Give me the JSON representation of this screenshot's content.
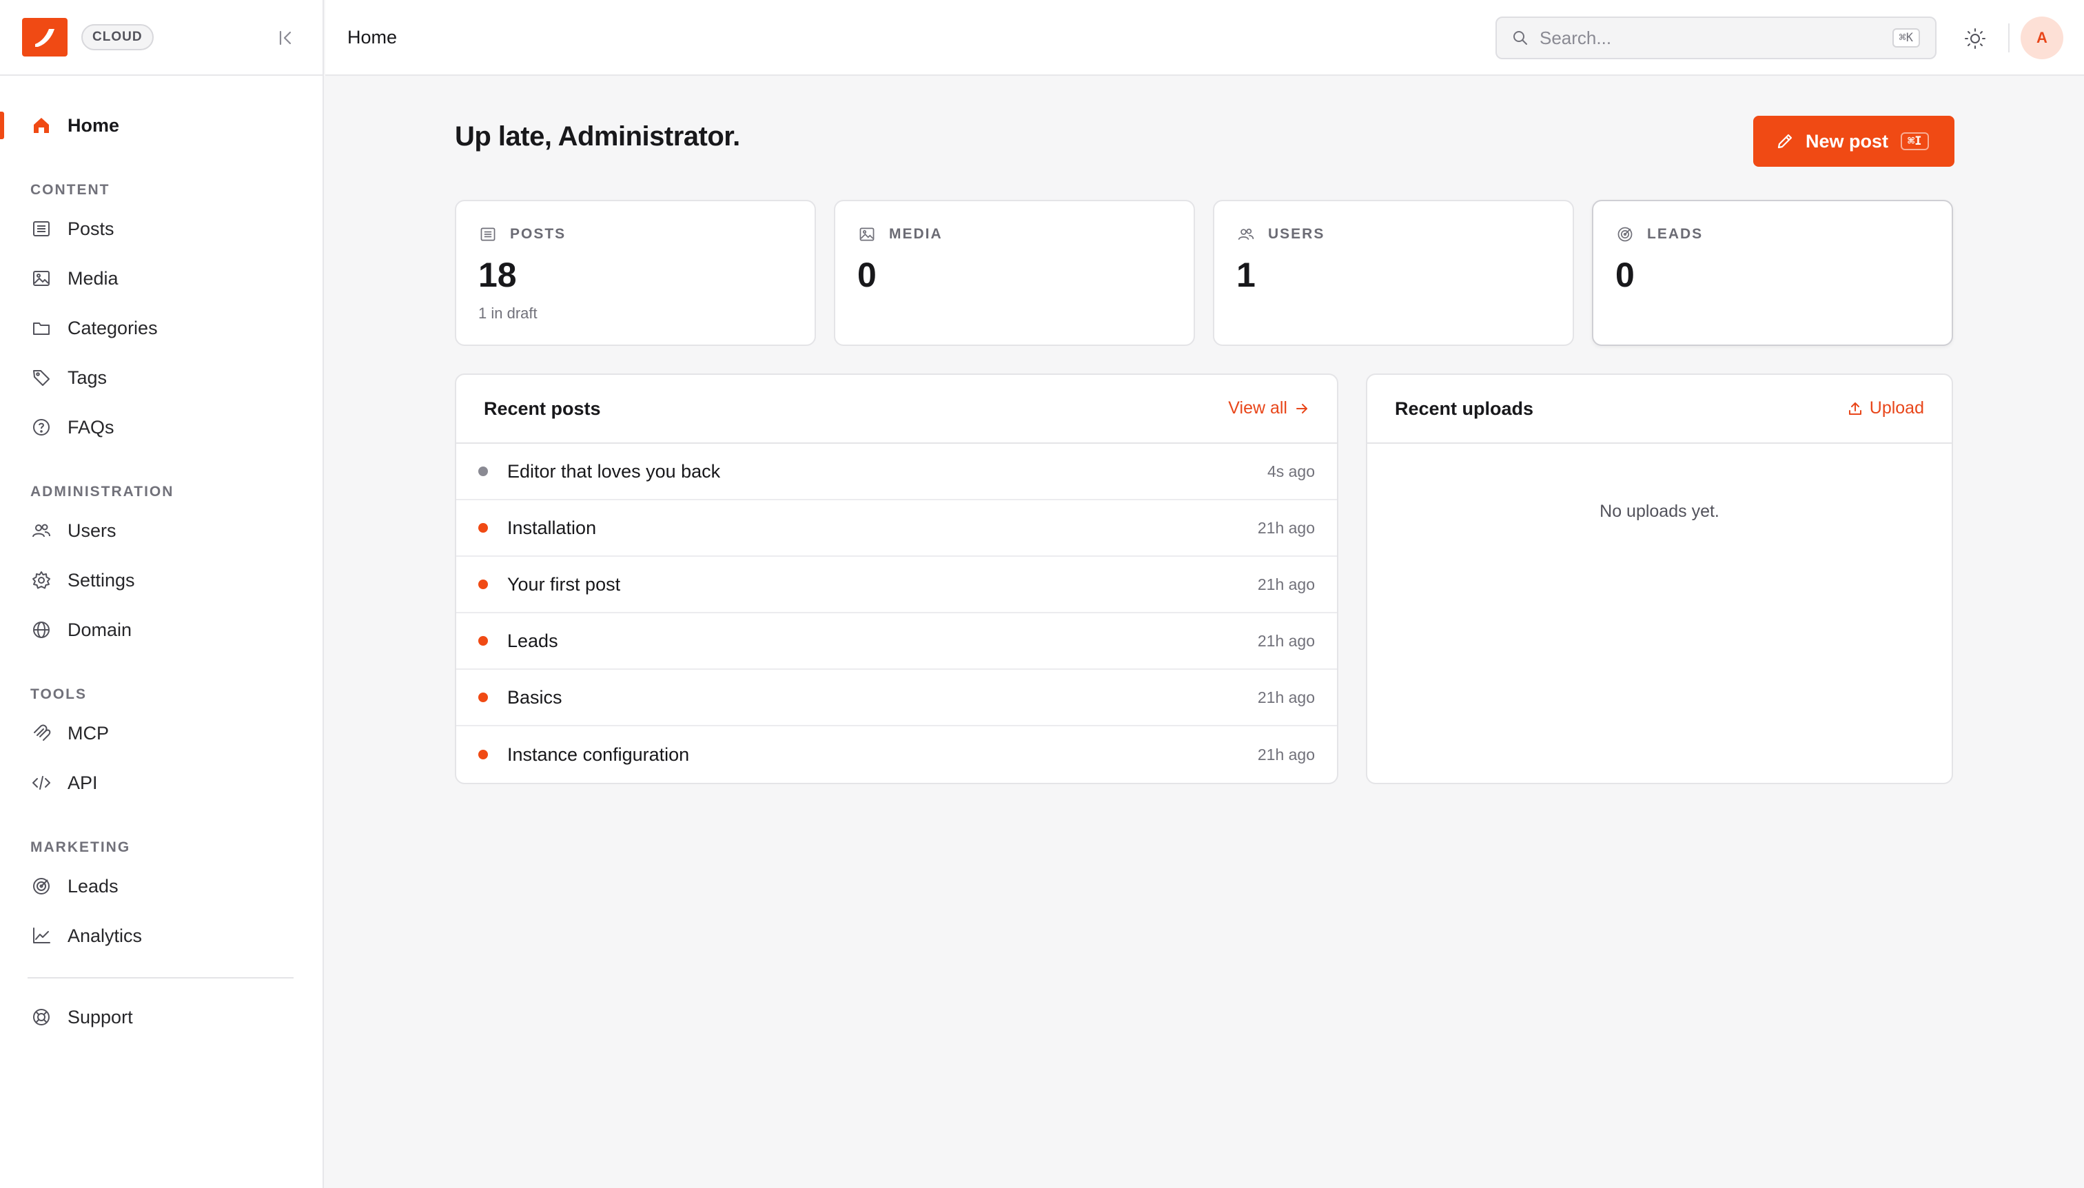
{
  "brand": {
    "badge": "CLOUD",
    "accent": "#f04a14"
  },
  "sidebar": {
    "home_label": "Home",
    "sections": {
      "content": {
        "label": "CONTENT",
        "items": [
          "Posts",
          "Media",
          "Categories",
          "Tags",
          "FAQs"
        ]
      },
      "administration": {
        "label": "ADMINISTRATION",
        "items": [
          "Users",
          "Settings",
          "Domain"
        ]
      },
      "tools": {
        "label": "TOOLS",
        "items": [
          "MCP",
          "API"
        ]
      },
      "marketing": {
        "label": "MARKETING",
        "items": [
          "Leads",
          "Analytics"
        ]
      }
    },
    "support_label": "Support"
  },
  "topbar": {
    "breadcrumb": "Home",
    "search_placeholder": "Search...",
    "search_shortcut": "⌘K",
    "avatar_initial": "A"
  },
  "main": {
    "greeting": "Up late, Administrator.",
    "new_post": {
      "label": "New post",
      "shortcut": "⌘I"
    },
    "stats": [
      {
        "label": "POSTS",
        "value": "18",
        "sub": "1 in draft"
      },
      {
        "label": "MEDIA",
        "value": "0",
        "sub": ""
      },
      {
        "label": "USERS",
        "value": "1",
        "sub": ""
      },
      {
        "label": "LEADS",
        "value": "0",
        "sub": ""
      }
    ],
    "recent_posts": {
      "title": "Recent posts",
      "link": "View all",
      "rows": [
        {
          "title": "Editor that loves you back",
          "time": "4s ago",
          "status_color": "#8a8a93"
        },
        {
          "title": "Installation",
          "time": "21h ago",
          "status_color": "#f04a14"
        },
        {
          "title": "Your first post",
          "time": "21h ago",
          "status_color": "#f04a14"
        },
        {
          "title": "Leads",
          "time": "21h ago",
          "status_color": "#f04a14"
        },
        {
          "title": "Basics",
          "time": "21h ago",
          "status_color": "#f04a14"
        },
        {
          "title": "Instance configuration",
          "time": "21h ago",
          "status_color": "#f04a14"
        }
      ]
    },
    "recent_uploads": {
      "title": "Recent uploads",
      "link": "Upload",
      "empty": "No uploads yet."
    }
  }
}
